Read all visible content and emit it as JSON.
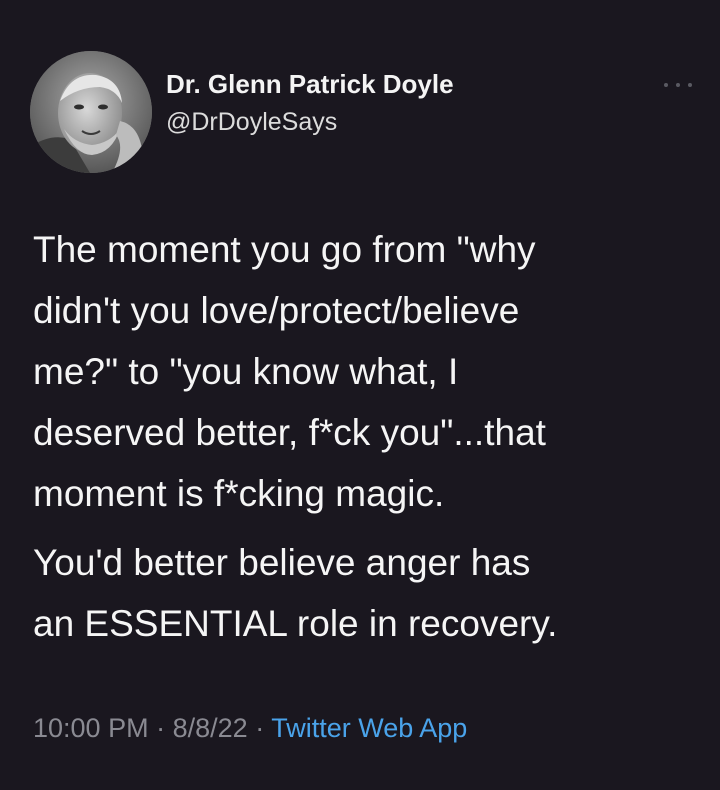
{
  "tweet": {
    "display_name": "Dr. Glenn Patrick Doyle",
    "handle": "@DrDoyleSays",
    "avatar_icon": "profile-photo",
    "more_icon": "more-options-icon",
    "paragraphs": [
      "The moment you go from \"why\ndidn't you love/protect/believe\nme?\" to \"you know what, I\ndeserved better, f*ck you\"...that\nmoment is f*cking magic.",
      "You'd better believe anger has\nan ESSENTIAL role in recovery."
    ],
    "time": "10:00 PM",
    "separator": "·",
    "date": "8/8/22",
    "source": "Twitter Web App"
  },
  "colors": {
    "background": "#1a171f",
    "text": "#f5f5f5",
    "meta": "#8a8a92",
    "link": "#4aa3ea"
  }
}
